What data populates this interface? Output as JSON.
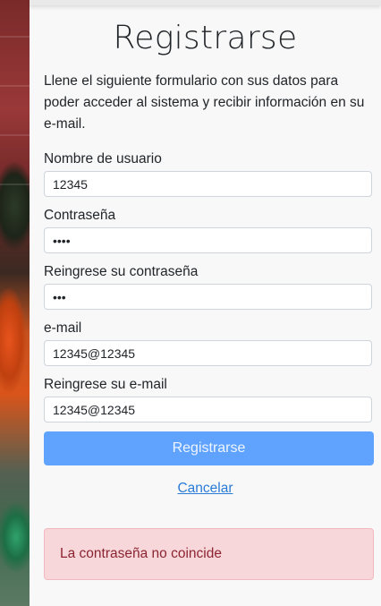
{
  "form": {
    "title": "Registrarse",
    "intro": "Llene el siguiente formulario con sus datos para poder acceder al sistema y recibir información en su e-mail.",
    "fields": {
      "username": {
        "label": "Nombre de usuario",
        "value": "12345"
      },
      "password": {
        "label": "Contraseña",
        "value": "••••"
      },
      "password_confirm": {
        "label": "Reingrese su contraseña",
        "value": "•••"
      },
      "email": {
        "label": "e-mail",
        "value": "12345@12345"
      },
      "email_confirm": {
        "label": "Reingrese su e-mail",
        "value": "12345@12345"
      }
    },
    "submit_label": "Registrarse",
    "cancel_label": "Cancelar",
    "error_message": "La contraseña no coincide"
  },
  "colors": {
    "primary_button": "#5fa3ff",
    "link": "#2b7bd6",
    "alert_bg": "#f8d7da",
    "alert_text": "#8a2430"
  }
}
